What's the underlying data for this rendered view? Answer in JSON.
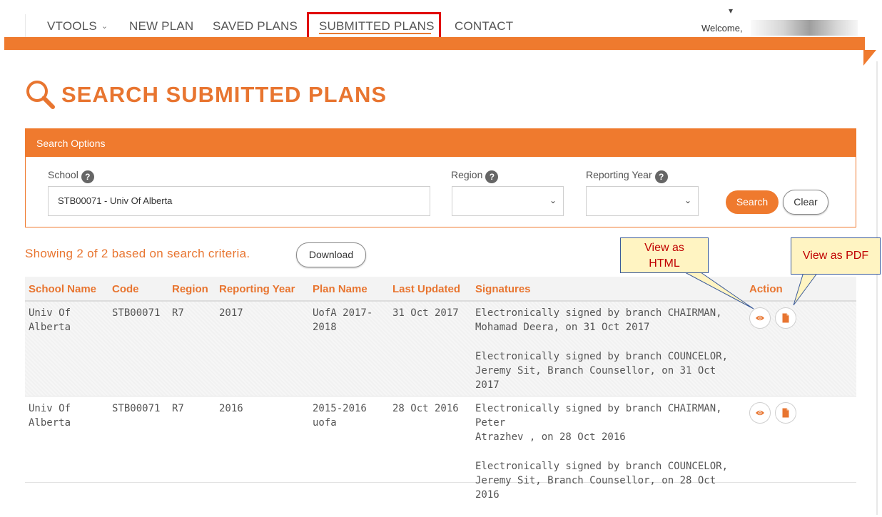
{
  "nav": {
    "items": [
      {
        "label": "VTOOLS",
        "has_dropdown": true
      },
      {
        "label": "NEW PLAN"
      },
      {
        "label": "SAVED PLANS"
      },
      {
        "label": "SUBMITTED PLANS",
        "active": true
      },
      {
        "label": "CONTACT"
      }
    ],
    "welcome": "Welcome,"
  },
  "page": {
    "title": "SEARCH SUBMITTED PLANS",
    "title_icon": "search-icon"
  },
  "search": {
    "header": "Search Options",
    "school_label": "School",
    "school_value": "STB00071 - Univ Of Alberta",
    "region_label": "Region",
    "region_value": "",
    "year_label": "Reporting Year",
    "year_value": "",
    "help_glyph": "?",
    "search_button": "Search",
    "clear_button": "Clear"
  },
  "results": {
    "summary": "Showing 2 of 2 based on search criteria.",
    "download_button": "Download",
    "columns": [
      "School Name",
      "Code",
      "Region",
      "Reporting Year",
      "Plan Name",
      "Last Updated",
      "Signatures",
      "Action"
    ],
    "rows": [
      {
        "school_name": [
          "Univ Of",
          "Alberta"
        ],
        "code": "STB00071",
        "region": "R7",
        "reporting_year": "2017",
        "plan_name": [
          "UofA 2017-",
          "2018"
        ],
        "last_updated": "31 Oct 2017",
        "signatures": [
          [
            "Electronically signed by branch CHAIRMAN,",
            "Mohamad Deera, on 31 Oct 2017"
          ],
          [
            "Electronically signed by branch COUNCELOR,",
            "Jeremy Sit, Branch Counsellor, on 31 Oct 2017"
          ]
        ]
      },
      {
        "school_name": [
          "Univ Of",
          "Alberta"
        ],
        "code": "STB00071",
        "region": "R7",
        "reporting_year": "2016",
        "plan_name": [
          "2015-2016",
          "uofa"
        ],
        "last_updated": "28 Oct 2016",
        "signatures": [
          [
            "Electronically signed by branch CHAIRMAN, Peter",
            "Atrazhev , on 28 Oct 2016"
          ],
          [
            "Electronically signed by branch COUNCELOR,",
            "Jeremy Sit, Branch Counsellor, on 28 Oct 2016"
          ]
        ]
      }
    ]
  },
  "callouts": {
    "html": [
      "View as",
      "HTML"
    ],
    "pdf": "View as PDF"
  },
  "colors": {
    "accent": "#ef7a2e",
    "title": "#e87530",
    "highlight_box": "#e00000",
    "callout_bg": "#fff4c2",
    "callout_text": "#c00000"
  },
  "icons": {
    "view_html": "eye-icon",
    "view_pdf": "file-icon"
  }
}
